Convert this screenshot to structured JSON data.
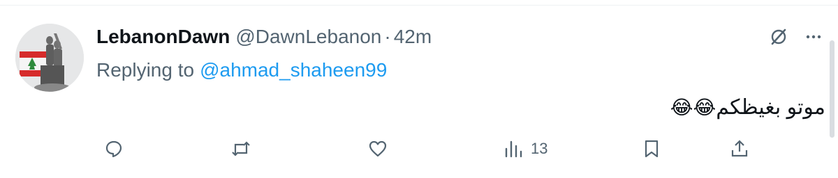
{
  "tweet": {
    "display_name": "LebanonDawn",
    "handle": "@DawnLebanon",
    "separator": "·",
    "time": "42m",
    "replying_prefix": "Replying to",
    "replying_handle": "@ahmad_shaheen99",
    "text": "موتو بغيظكم",
    "emojis": "😂😂"
  },
  "actions": {
    "reply": {
      "icon": "reply-icon"
    },
    "retweet": {
      "icon": "retweet-icon"
    },
    "like": {
      "icon": "like-icon"
    },
    "views": {
      "icon": "views-icon",
      "count": "13"
    },
    "bookmark": {
      "icon": "bookmark-icon"
    },
    "share": {
      "icon": "share-icon"
    }
  },
  "colors": {
    "text": "#0f1419",
    "muted": "#536471",
    "link": "#1d9bf0"
  }
}
